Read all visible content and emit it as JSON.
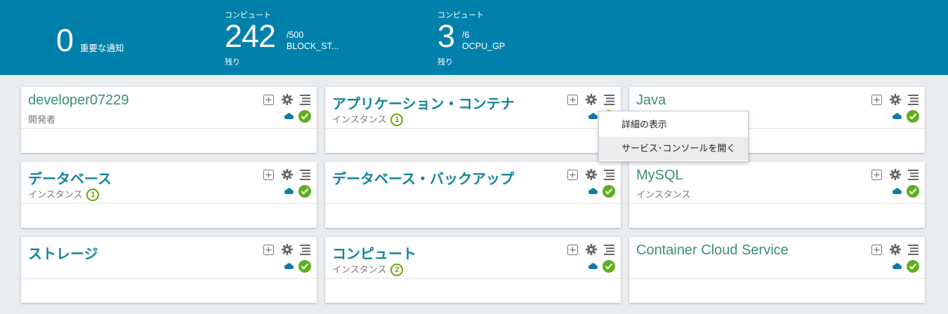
{
  "header": {
    "notifications": {
      "value": "0",
      "label": "重要な通知"
    },
    "metric1": {
      "top": "コンピュート",
      "value": "242",
      "limit": "/500",
      "name": "BLOCK_ST...",
      "bottom": "残り"
    },
    "metric2": {
      "top": "コンピュート",
      "value": "3",
      "limit": "/6",
      "name": "OCPU_GP",
      "bottom": "残り"
    }
  },
  "cards": [
    {
      "title": "developer07229",
      "subtitle": "開発者",
      "count": ""
    },
    {
      "title": "アプリケーション・コンテナ",
      "subtitle": "インスタンス",
      "count": "1"
    },
    {
      "title": "Java",
      "subtitle": "",
      "count": ""
    },
    {
      "title": "データベース",
      "subtitle": "インスタンス",
      "count": "1"
    },
    {
      "title": "データベース・バックアップ",
      "subtitle": "",
      "count": ""
    },
    {
      "title": "MySQL",
      "subtitle": "インスタンス",
      "count": ""
    },
    {
      "title": "ストレージ",
      "subtitle": "",
      "count": ""
    },
    {
      "title": "コンピュート",
      "subtitle": "インスタンス",
      "count": "2"
    },
    {
      "title": "Container Cloud Service",
      "subtitle": "",
      "count": ""
    }
  ],
  "context_menu": {
    "items": [
      "詳細の表示",
      "サービス･コンソールを開く"
    ]
  },
  "colors": {
    "header_bg": "#0081ac",
    "status_ok": "#5fae1c",
    "title_teal": "#10859a"
  }
}
